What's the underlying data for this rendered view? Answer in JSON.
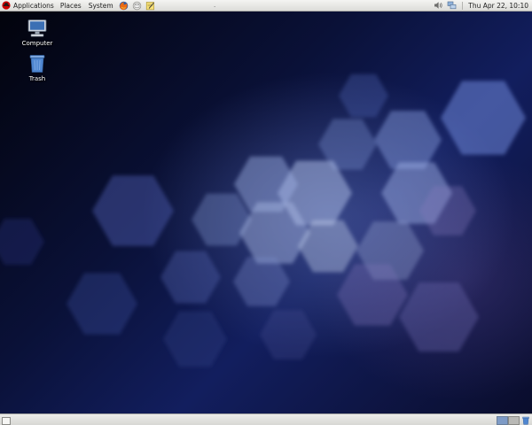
{
  "top_panel": {
    "menus": {
      "applications": "Applications",
      "places": "Places",
      "system": "System"
    },
    "launchers": [
      "firefox-icon",
      "email-icon",
      "notes-icon"
    ],
    "status_icons": [
      "volume-icon",
      "network-icon"
    ],
    "clock": "Thu Apr 22, 10:10",
    "center_mark": "."
  },
  "desktop": {
    "icons": [
      {
        "name": "computer-icon",
        "label": "Computer"
      },
      {
        "name": "trash-icon",
        "label": "Trash"
      }
    ]
  },
  "bottom_panel": {
    "workspaces": 2,
    "active_workspace": 1
  },
  "colors": {
    "panel": "#dcdcd8",
    "desktop_dark": "#05081c",
    "desktop_accent": "#3a4a9c",
    "workspace_active": "#7e9bc6"
  }
}
